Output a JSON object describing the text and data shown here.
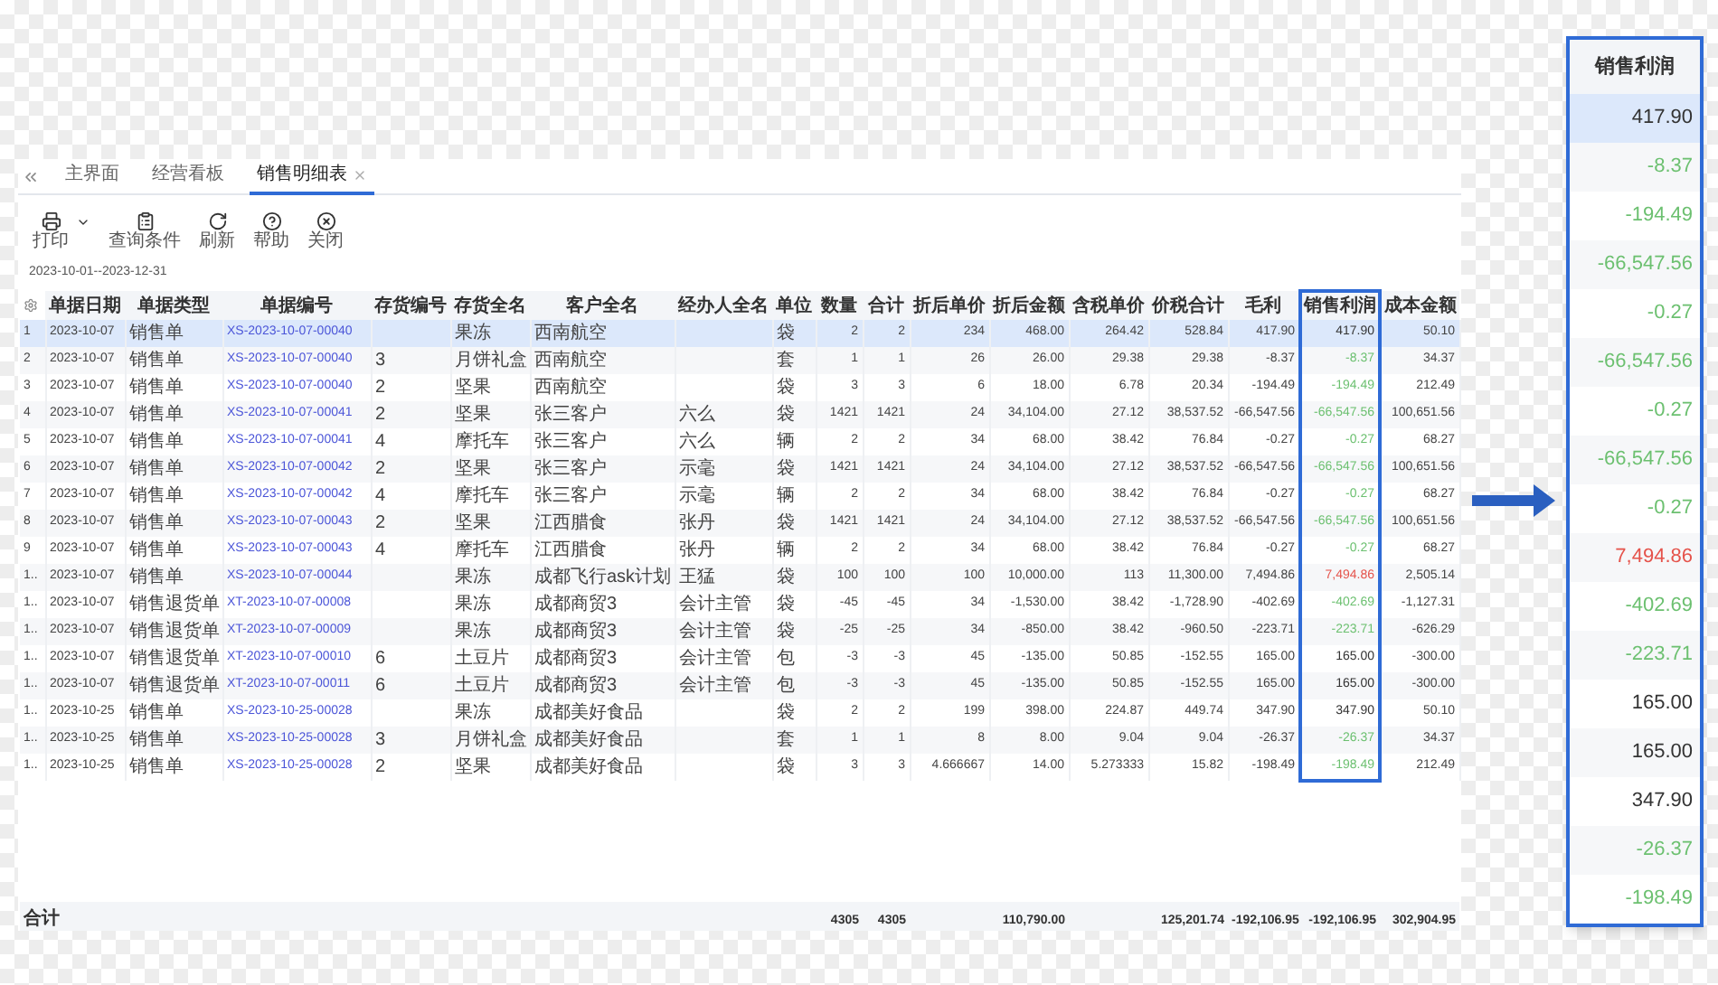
{
  "tabs": [
    {
      "label": "主界面",
      "selected": false
    },
    {
      "label": "经营看板",
      "selected": false
    },
    {
      "label": "销售明细表",
      "selected": true
    }
  ],
  "toolbar": [
    {
      "kind": "printer",
      "label": "打印"
    },
    {
      "kind": "clipboard",
      "label": "查询条件"
    },
    {
      "kind": "refresh",
      "label": "刷新"
    },
    {
      "kind": "help",
      "label": "帮助"
    },
    {
      "kind": "close",
      "label": "关闭"
    }
  ],
  "date_range": "2023-10-01--2023-12-31",
  "table": {
    "columns": [
      "",
      "单据日期",
      "单据类型",
      "单据编号",
      "存货编号",
      "存货全名",
      "客户全名",
      "经办人全名",
      "单位",
      "数量",
      "合计",
      "折后单价",
      "折后金额",
      "含税单价",
      "价税合计",
      "毛利",
      "销售利润",
      "成本金额"
    ],
    "rows": [
      {
        "selected": true,
        "color": "#333333",
        "cells": [
          "1",
          "2023-10-07",
          "销售单",
          "XS-2023-10-07-00040",
          null,
          "果冻",
          "西南航空",
          null,
          "袋",
          "2",
          "2",
          "234",
          "468.00",
          "264.42",
          "528.84",
          "417.90",
          "417.90",
          "50.10"
        ]
      },
      {
        "selected": false,
        "color": "#6cc070",
        "cells": [
          "2",
          "2023-10-07",
          "销售单",
          "XS-2023-10-07-00040",
          "3",
          "月饼礼盒",
          "西南航空",
          null,
          "套",
          "1",
          "1",
          "26",
          "26.00",
          "29.38",
          "29.38",
          "-8.37",
          "-8.37",
          "34.37"
        ]
      },
      {
        "selected": false,
        "color": "#6cc070",
        "cells": [
          "3",
          "2023-10-07",
          "销售单",
          "XS-2023-10-07-00040",
          "2",
          "坚果",
          "西南航空",
          null,
          "袋",
          "3",
          "3",
          "6",
          "18.00",
          "6.78",
          "20.34",
          "-194.49",
          "-194.49",
          "212.49"
        ]
      },
      {
        "selected": false,
        "color": "#6cc070",
        "cells": [
          "4",
          "2023-10-07",
          "销售单",
          "XS-2023-10-07-00041",
          "2",
          "坚果",
          "张三客户",
          "六么",
          "袋",
          "1421",
          "1421",
          "24",
          "34,104.00",
          "27.12",
          "38,537.52",
          "-66,547.56",
          "-66,547.56",
          "100,651.56"
        ]
      },
      {
        "selected": false,
        "color": "#6cc070",
        "cells": [
          "5",
          "2023-10-07",
          "销售单",
          "XS-2023-10-07-00041",
          "4",
          "摩托车",
          "张三客户",
          "六么",
          "辆",
          "2",
          "2",
          "34",
          "68.00",
          "38.42",
          "76.84",
          "-0.27",
          "-0.27",
          "68.27"
        ]
      },
      {
        "selected": false,
        "color": "#6cc070",
        "cells": [
          "6",
          "2023-10-07",
          "销售单",
          "XS-2023-10-07-00042",
          "2",
          "坚果",
          "张三客户",
          "示毫",
          "袋",
          "1421",
          "1421",
          "24",
          "34,104.00",
          "27.12",
          "38,537.52",
          "-66,547.56",
          "-66,547.56",
          "100,651.56"
        ]
      },
      {
        "selected": false,
        "color": "#6cc070",
        "cells": [
          "7",
          "2023-10-07",
          "销售单",
          "XS-2023-10-07-00042",
          "4",
          "摩托车",
          "张三客户",
          "示毫",
          "辆",
          "2",
          "2",
          "34",
          "68.00",
          "38.42",
          "76.84",
          "-0.27",
          "-0.27",
          "68.27"
        ]
      },
      {
        "selected": false,
        "color": "#6cc070",
        "cells": [
          "8",
          "2023-10-07",
          "销售单",
          "XS-2023-10-07-00043",
          "2",
          "坚果",
          "江西腊食",
          "张丹",
          "袋",
          "1421",
          "1421",
          "24",
          "34,104.00",
          "27.12",
          "38,537.52",
          "-66,547.56",
          "-66,547.56",
          "100,651.56"
        ]
      },
      {
        "selected": false,
        "color": "#6cc070",
        "cells": [
          "9",
          "2023-10-07",
          "销售单",
          "XS-2023-10-07-00043",
          "4",
          "摩托车",
          "江西腊食",
          "张丹",
          "辆",
          "2",
          "2",
          "34",
          "68.00",
          "38.42",
          "76.84",
          "-0.27",
          "-0.27",
          "68.27"
        ]
      },
      {
        "selected": false,
        "color": "#e5534b",
        "cells": [
          "1..",
          "2023-10-07",
          "销售单",
          "XS-2023-10-07-00044",
          null,
          "果冻",
          "成都飞行ask计划",
          "王猛",
          "袋",
          "100",
          "100",
          "100",
          "10,000.00",
          "113",
          "11,300.00",
          "7,494.86",
          "7,494.86",
          "2,505.14"
        ]
      },
      {
        "selected": false,
        "color": "#6cc070",
        "cells": [
          "1..",
          "2023-10-07",
          "销售退货单",
          "XT-2023-10-07-00008",
          null,
          "果冻",
          "成都商贸3",
          "会计主管",
          "袋",
          "-45",
          "-45",
          "34",
          "-1,530.00",
          "38.42",
          "-1,728.90",
          "-402.69",
          "-402.69",
          "-1,127.31"
        ]
      },
      {
        "selected": false,
        "color": "#6cc070",
        "cells": [
          "1..",
          "2023-10-07",
          "销售退货单",
          "XT-2023-10-07-00009",
          null,
          "果冻",
          "成都商贸3",
          "会计主管",
          "袋",
          "-25",
          "-25",
          "34",
          "-850.00",
          "38.42",
          "-960.50",
          "-223.71",
          "-223.71",
          "-626.29"
        ]
      },
      {
        "selected": false,
        "color": "#333333",
        "cells": [
          "1..",
          "2023-10-07",
          "销售退货单",
          "XT-2023-10-07-00010",
          "6",
          "土豆片",
          "成都商贸3",
          "会计主管",
          "包",
          "-3",
          "-3",
          "45",
          "-135.00",
          "50.85",
          "-152.55",
          "165.00",
          "165.00",
          "-300.00"
        ]
      },
      {
        "selected": false,
        "color": "#333333",
        "cells": [
          "1..",
          "2023-10-07",
          "销售退货单",
          "XT-2023-10-07-00011",
          "6",
          "土豆片",
          "成都商贸3",
          "会计主管",
          "包",
          "-3",
          "-3",
          "45",
          "-135.00",
          "50.85",
          "-152.55",
          "165.00",
          "165.00",
          "-300.00"
        ]
      },
      {
        "selected": false,
        "color": "#333333",
        "cells": [
          "1..",
          "2023-10-25",
          "销售单",
          "XS-2023-10-25-00028",
          null,
          "果冻",
          "成都美好食品",
          null,
          "袋",
          "2",
          "2",
          "199",
          "398.00",
          "224.87",
          "449.74",
          "347.90",
          "347.90",
          "50.10"
        ]
      },
      {
        "selected": false,
        "color": "#6cc070",
        "cells": [
          "1..",
          "2023-10-25",
          "销售单",
          "XS-2023-10-25-00028",
          "3",
          "月饼礼盒",
          "成都美好食品",
          null,
          "套",
          "1",
          "1",
          "8",
          "8.00",
          "9.04",
          "9.04",
          "-26.37",
          "-26.37",
          "34.37"
        ]
      },
      {
        "selected": false,
        "color": "#6cc070",
        "cells": [
          "1..",
          "2023-10-25",
          "销售单",
          "XS-2023-10-25-00028",
          "2",
          "坚果",
          "成都美好食品",
          null,
          "袋",
          "3",
          "3",
          "4.666667",
          "14.00",
          "5.273333",
          "15.82",
          "-198.49",
          "-198.49",
          "212.49"
        ]
      }
    ],
    "totals": {
      "label": "合计",
      "quantity": "4305",
      "total": "4305",
      "discount_amount": "110,790.00",
      "tax_total": "125,201.74",
      "gross_profit": "-192,106.95",
      "sales_profit": "-192,106.95",
      "cost_amount": "302,904.95"
    }
  },
  "zoom_panel": {
    "title": "销售利润",
    "values": [
      {
        "value": "417.90",
        "color": "#333333",
        "selected": true
      },
      {
        "value": "-8.37",
        "color": "#6cc070",
        "selected": false
      },
      {
        "value": "-194.49",
        "color": "#6cc070",
        "selected": false
      },
      {
        "value": "-66,547.56",
        "color": "#6cc070",
        "selected": false
      },
      {
        "value": "-0.27",
        "color": "#6cc070",
        "selected": false
      },
      {
        "value": "-66,547.56",
        "color": "#6cc070",
        "selected": false
      },
      {
        "value": "-0.27",
        "color": "#6cc070",
        "selected": false
      },
      {
        "value": "-66,547.56",
        "color": "#6cc070",
        "selected": false
      },
      {
        "value": "-0.27",
        "color": "#6cc070",
        "selected": false
      },
      {
        "value": "7,494.86",
        "color": "#e5534b",
        "selected": false
      },
      {
        "value": "-402.69",
        "color": "#6cc070",
        "selected": false
      },
      {
        "value": "-223.71",
        "color": "#6cc070",
        "selected": false
      },
      {
        "value": "165.00",
        "color": "#333333",
        "selected": false
      },
      {
        "value": "165.00",
        "color": "#333333",
        "selected": false
      },
      {
        "value": "347.90",
        "color": "#333333",
        "selected": false
      },
      {
        "value": "-26.37",
        "color": "#6cc070",
        "selected": false
      },
      {
        "value": "-198.49",
        "color": "#6cc070",
        "selected": false
      }
    ]
  }
}
